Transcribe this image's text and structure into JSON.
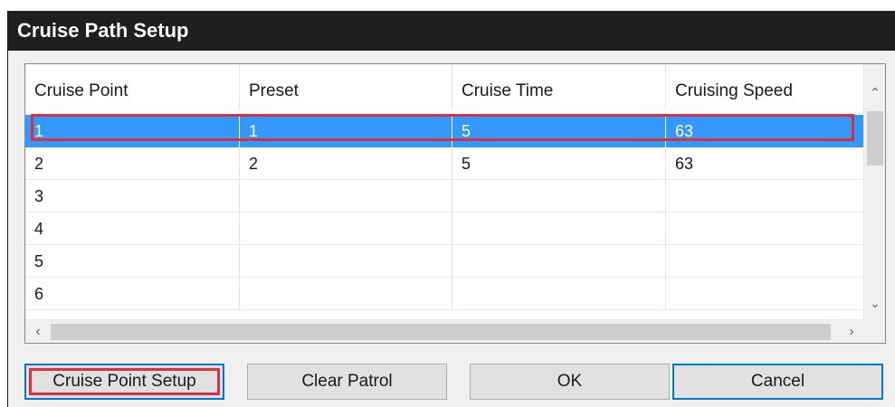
{
  "window": {
    "title": "Cruise Path Setup"
  },
  "table": {
    "columns": [
      "Cruise Point",
      "Preset",
      "Cruise Time",
      "Cruising Speed"
    ],
    "rows": [
      {
        "cruise_point": "1",
        "preset": "1",
        "cruise_time": "5",
        "cruising_speed": "63",
        "selected": true
      },
      {
        "cruise_point": "2",
        "preset": "2",
        "cruise_time": "5",
        "cruising_speed": "63",
        "selected": false
      },
      {
        "cruise_point": "3",
        "preset": "",
        "cruise_time": "",
        "cruising_speed": "",
        "selected": false
      },
      {
        "cruise_point": "4",
        "preset": "",
        "cruise_time": "",
        "cruising_speed": "",
        "selected": false
      },
      {
        "cruise_point": "5",
        "preset": "",
        "cruise_time": "",
        "cruising_speed": "",
        "selected": false
      },
      {
        "cruise_point": "6",
        "preset": "",
        "cruise_time": "",
        "cruising_speed": "",
        "selected": false
      }
    ]
  },
  "buttons": {
    "cruise_point_setup": "Cruise Point Setup",
    "clear_patrol": "Clear Patrol",
    "ok": "OK",
    "cancel": "Cancel"
  },
  "icons": {
    "scroll_up": "chevron-up-icon",
    "scroll_down": "chevron-down-icon",
    "scroll_left": "chevron-left-icon",
    "scroll_right": "chevron-right-icon"
  },
  "colors": {
    "titlebar": "#1f1f1f",
    "selection": "#3399ff",
    "highlight_outline": "#d9303c",
    "focus_border": "#0078d7"
  }
}
